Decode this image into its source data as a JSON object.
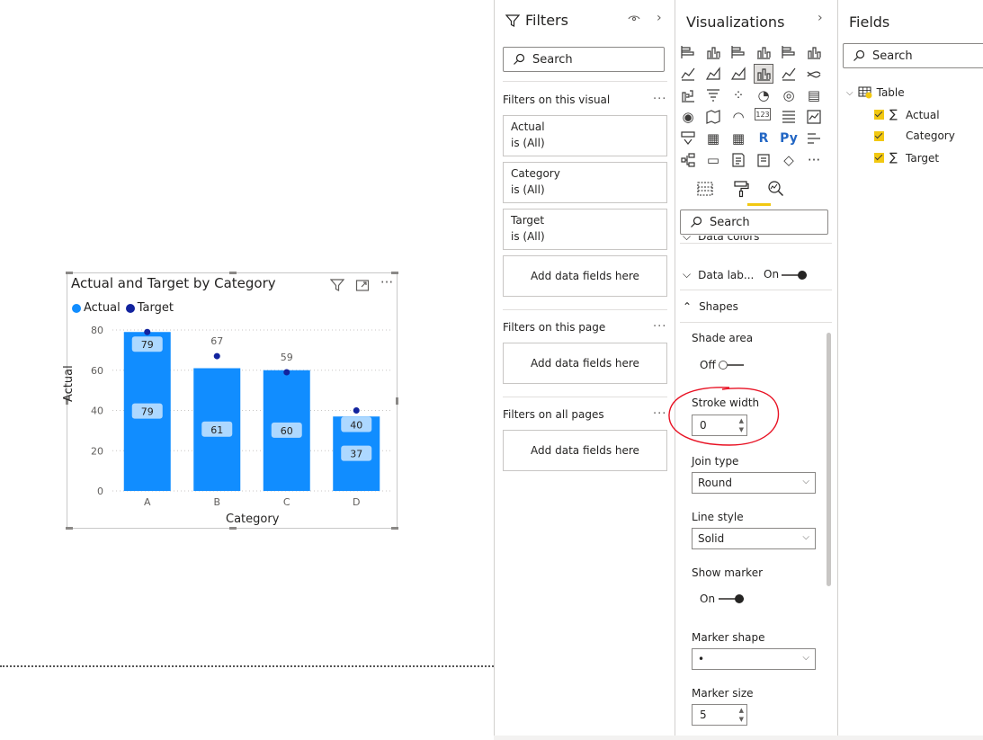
{
  "visual": {
    "title": "Actual and Target by Category",
    "legend": [
      {
        "label": "Actual",
        "color": "#118dff"
      },
      {
        "label": "Target",
        "color": "#12239e"
      }
    ],
    "icons": [
      "filter-icon",
      "focus-mode-icon",
      "more-options-icon"
    ]
  },
  "chart_data": {
    "type": "bar",
    "title": "Actual and Target by Category",
    "xlabel": "Category",
    "ylabel": "Actual",
    "categories": [
      "A",
      "B",
      "C",
      "D"
    ],
    "ylim": [
      0,
      80
    ],
    "yticks": [
      0,
      20,
      40,
      60,
      80
    ],
    "grid": true,
    "legend_position": "top-left",
    "series": [
      {
        "name": "Actual",
        "type": "bar",
        "color": "#118dff",
        "values": [
          79,
          61,
          60,
          37
        ],
        "labels": [
          "79",
          "61",
          "60",
          "37"
        ]
      },
      {
        "name": "Target",
        "type": "line-markers",
        "color": "#12239e",
        "values": [
          79,
          67,
          59,
          40
        ],
        "labels": [
          "79",
          "67",
          "59",
          "40"
        ]
      }
    ]
  },
  "filters": {
    "title": "Filters",
    "search_placeholder": "Search",
    "on_visual_label": "Filters on this visual",
    "cards": [
      {
        "field": "Actual",
        "state": "is (All)"
      },
      {
        "field": "Category",
        "state": "is (All)"
      },
      {
        "field": "Target",
        "state": "is (All)"
      }
    ],
    "add_fields": "Add data fields here",
    "on_page_label": "Filters on this page",
    "on_all_label": "Filters on all pages",
    "more": "···"
  },
  "visualizations": {
    "title": "Visualizations",
    "search_placeholder": "Search",
    "sections": {
      "data_colors": "Data colors",
      "data_labels": "Data lab...",
      "data_labels_state": "On",
      "shapes": "Shapes"
    },
    "shapes": {
      "shade_area_label": "Shade area",
      "shade_area_state": "Off",
      "stroke_width_label": "Stroke width",
      "stroke_width_value": "0",
      "join_type_label": "Join type",
      "join_type_value": "Round",
      "line_style_label": "Line style",
      "line_style_value": "Solid",
      "show_marker_label": "Show marker",
      "show_marker_state": "On",
      "marker_shape_label": "Marker shape",
      "marker_shape_value": "•",
      "marker_size_label": "Marker size",
      "marker_size_value": "5"
    },
    "annotation_color": "#e81123"
  },
  "fields": {
    "title": "Fields",
    "search_placeholder": "Search",
    "table_name": "Table",
    "items": [
      {
        "name": "Actual",
        "sigma": "∑",
        "checked": true
      },
      {
        "name": "Category",
        "sigma": "",
        "checked": true
      },
      {
        "name": "Target",
        "sigma": "∑",
        "checked": true
      }
    ]
  },
  "colors": {
    "accent": "#f2c811",
    "bar": "#118dff",
    "marker": "#12239e"
  }
}
